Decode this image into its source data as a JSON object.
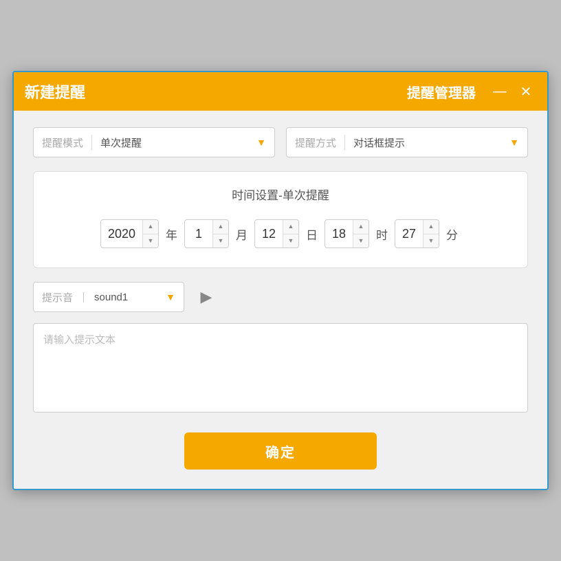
{
  "titlebar": {
    "new_reminder_label": "新建提醒",
    "app_name": "提醒管理器",
    "minimize_btn": "—",
    "close_btn": "✕"
  },
  "top_dropdowns": {
    "mode_label": "提醒模式",
    "mode_value": "单次提醒",
    "method_label": "提醒方式",
    "method_value": "对话框提示"
  },
  "time_section": {
    "title": "时间设置-单次提醒",
    "year": "2020",
    "year_unit": "年",
    "month": "1",
    "month_unit": "月",
    "day": "12",
    "day_unit": "日",
    "hour": "18",
    "hour_unit": "时",
    "minute": "27",
    "minute_unit": "分"
  },
  "sound": {
    "label": "提示音",
    "separator": "｜",
    "value": "sound1"
  },
  "text_area": {
    "placeholder": "请输入提示文本"
  },
  "confirm": {
    "label": "确定"
  }
}
